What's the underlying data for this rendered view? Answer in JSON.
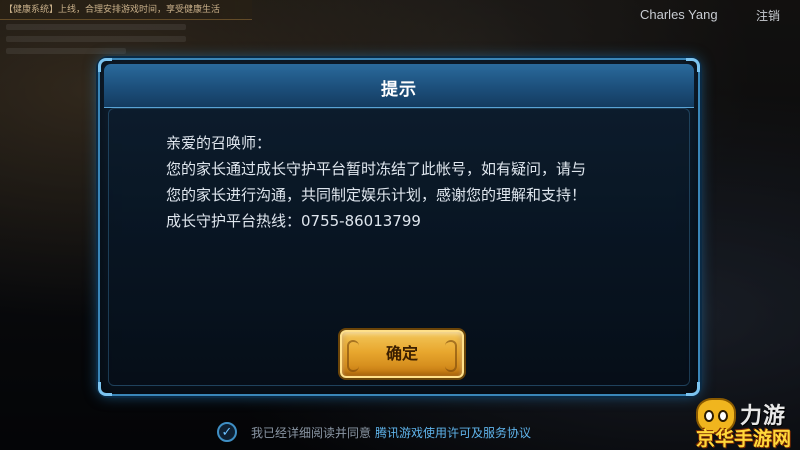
{
  "top_notice": {
    "text": "【健康系统】上线，合理安排游戏时间，享受健康生活"
  },
  "user": {
    "name": "Charles  Yang",
    "logout_label": "注销"
  },
  "dialog": {
    "title": "提示",
    "message_lines": [
      "亲爱的召唤师：",
      "您的家长通过成长守护平台暂时冻结了此帐号，如有疑问，请与",
      "您的家长进行沟通，共同制定娱乐计划，感谢您的理解和支持！",
      "成长守护平台热线：0755-86013799"
    ],
    "confirm_label": "确定"
  },
  "agreement": {
    "text": "我已经详细阅读并同意",
    "link": "腾讯游戏使用许可及服务协议",
    "checked": true
  },
  "watermark": {
    "line1": "力游",
    "line2": "京华手游网"
  },
  "colors": {
    "dialog_border": "#3a86b8",
    "button_gold": "#e8a72e",
    "link_blue": "#5fb3ea"
  }
}
